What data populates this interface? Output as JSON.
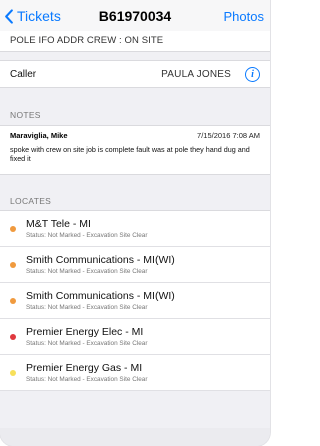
{
  "nav": {
    "back_label": "Tickets",
    "title": "B61970034",
    "right_label": "Photos"
  },
  "pole_line": "POLE IFO ADDR CREW : ON SITE",
  "caller": {
    "label": "Caller",
    "value": "PAULA JONES",
    "info_icon": "i"
  },
  "notes": {
    "header": "NOTES",
    "items": [
      {
        "author": "Maraviglia, Mike",
        "date": "7/15/2016 7:08 AM",
        "text": "spoke with crew on site job is complete fault was at pole they hand dug and fixed it"
      }
    ]
  },
  "locates": {
    "header": "LOCATES",
    "items": [
      {
        "name": "M&T Tele - MI",
        "status": "Status: Not Marked - Excavation Site Clear",
        "color": "#f09a3e"
      },
      {
        "name": "Smith Communications - MI(WI)",
        "status": "Status: Not Marked - Excavation Site Clear",
        "color": "#f09a3e"
      },
      {
        "name": "Smith Communications - MI(WI)",
        "status": "Status: Not Marked - Excavation Site Clear",
        "color": "#f09a3e"
      },
      {
        "name": "Premier Energy Elec - MI",
        "status": "Status: Not Marked - Excavation Site Clear",
        "color": "#e0383e"
      },
      {
        "name": "Premier Energy Gas - MI",
        "status": "Status: Not Marked - Excavation Site Clear",
        "color": "#f7e05a"
      }
    ]
  },
  "colors": {
    "accent": "#0a7aff"
  }
}
